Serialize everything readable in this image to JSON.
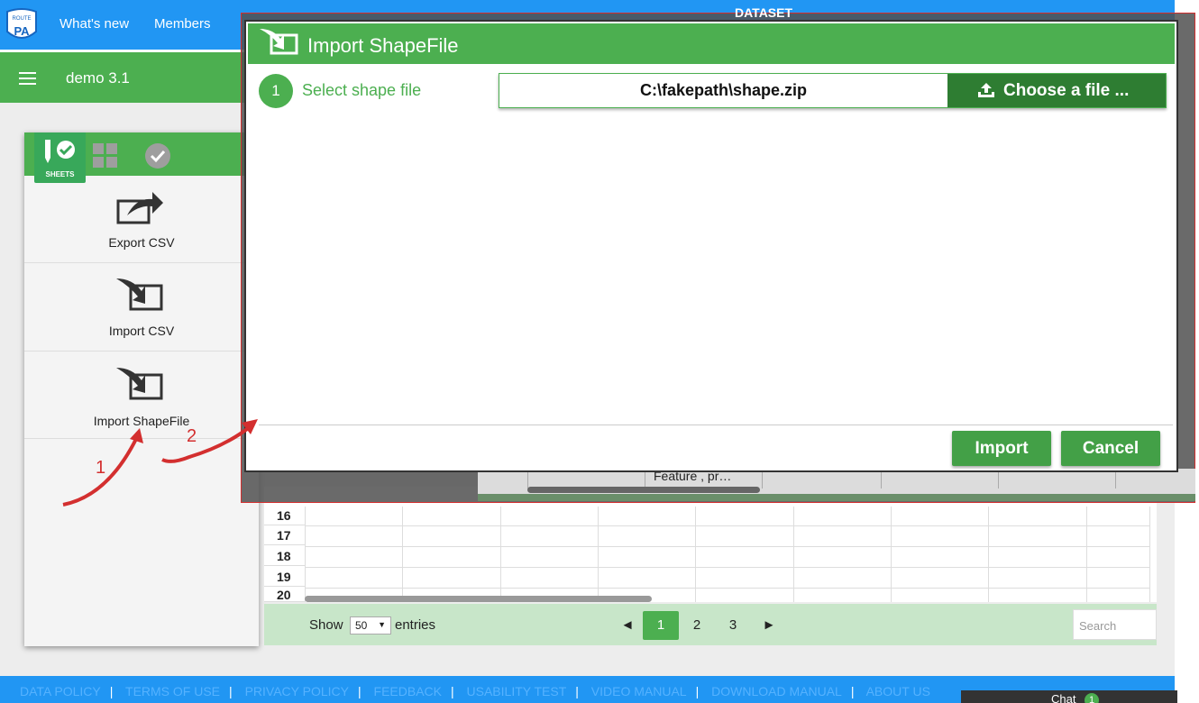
{
  "topnav": {
    "logo_text": "ROUTE TO PA",
    "links": [
      "What's new",
      "Members"
    ]
  },
  "appbar": {
    "title": "demo 3.1"
  },
  "dataset_title": "DATASET",
  "side_panel": {
    "sheets_label": "SHEETS",
    "items": [
      {
        "label": "Export CSV",
        "icon": "export-icon"
      },
      {
        "label": "Import CSV",
        "icon": "import-icon"
      },
      {
        "label": "Import ShapeFile",
        "icon": "import-icon"
      }
    ]
  },
  "modal": {
    "title": "Import ShapeFile",
    "step": {
      "number": "1",
      "label": "Select shape file"
    },
    "file_path": "C:\\fakepath\\shape.zip",
    "choose_label": "Choose a file ...",
    "import_label": "Import",
    "cancel_label": "Cancel"
  },
  "peek": {
    "cell_text": "Feature , pr…"
  },
  "grid": {
    "row_numbers": [
      "16",
      "17",
      "18",
      "19",
      "20"
    ]
  },
  "pager": {
    "show_label": "Show",
    "page_size": "50",
    "entries_label": "entries",
    "prev_glyph": "◄",
    "next_glyph": "►",
    "pages": [
      "1",
      "2",
      "3"
    ],
    "current_page": "1",
    "search_placeholder": "Search"
  },
  "footer": {
    "links": [
      "DATA POLICY",
      "TERMS OF USE",
      "PRIVACY POLICY",
      "FEEDBACK",
      "USABILITY TEST",
      "VIDEO MANUAL",
      "DOWNLOAD MANUAL",
      "ABOUT US"
    ]
  },
  "chat": {
    "label": "Chat",
    "badge": "1"
  },
  "annotations": {
    "one": "1",
    "two": "2"
  },
  "colors": {
    "brand_blue": "#2196f3",
    "brand_green": "#4caf50",
    "dark_green": "#2e7d32",
    "annotation_red": "#d32f2f"
  }
}
